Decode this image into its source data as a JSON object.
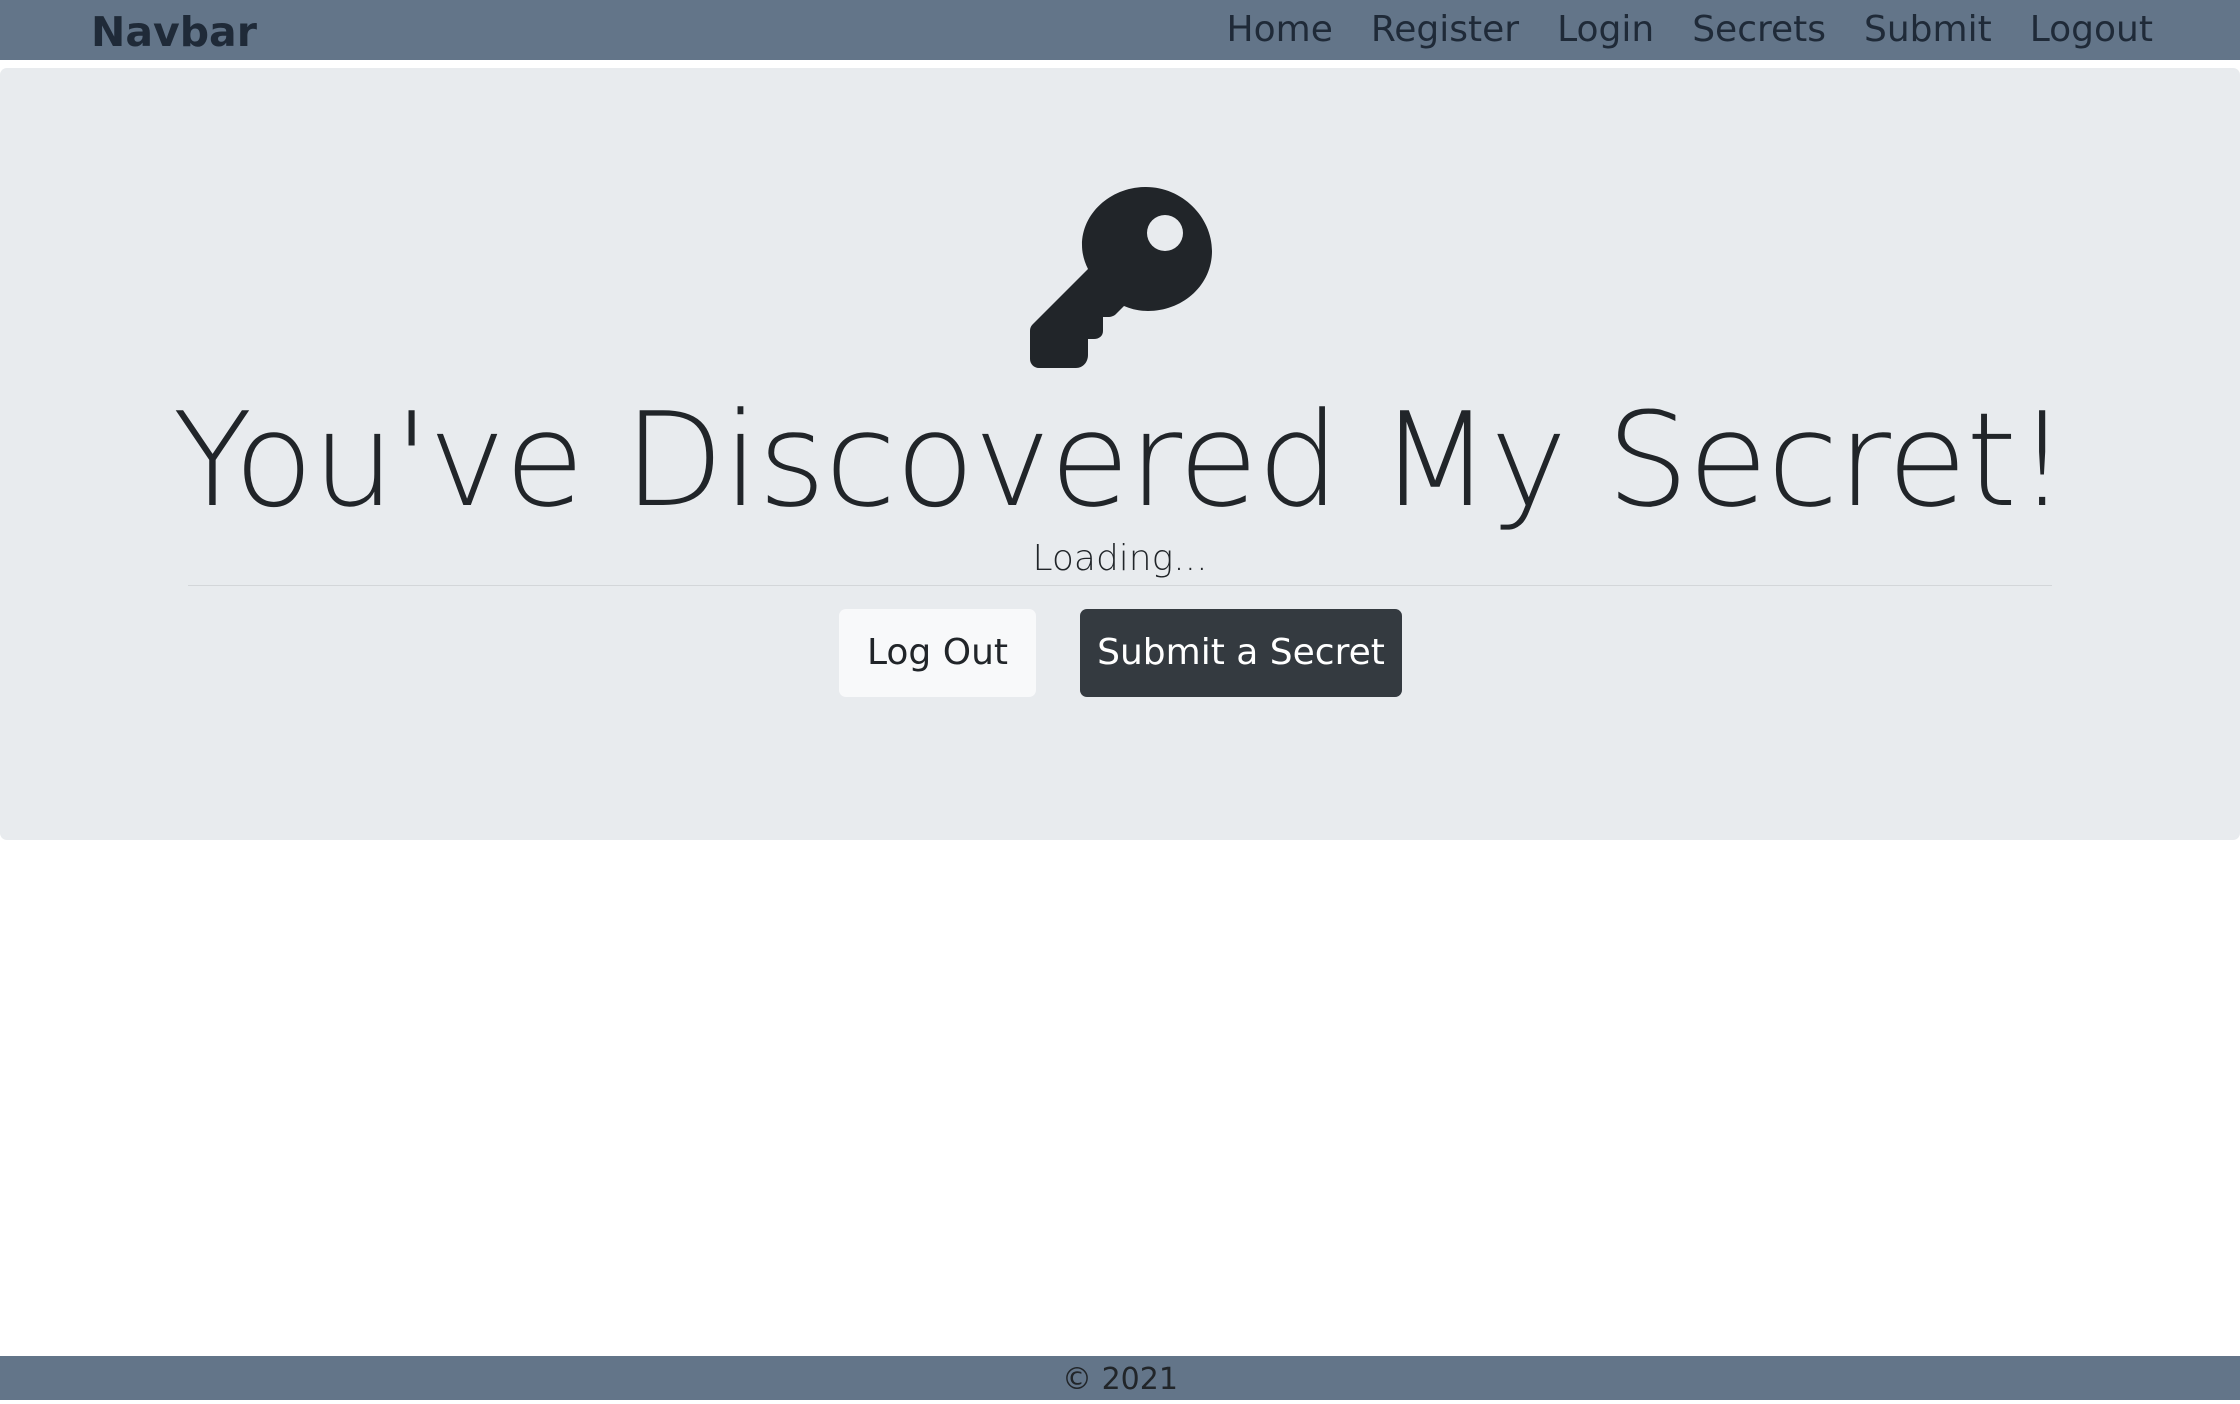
{
  "navbar": {
    "brand": "Navbar",
    "links": [
      "Home",
      "Register",
      "Login",
      "Secrets",
      "Submit",
      "Logout"
    ]
  },
  "hero": {
    "icon": "key-icon",
    "title": "You've Discovered My Secret!",
    "status": "Loading...",
    "buttons": {
      "logout": "Log Out",
      "submit": "Submit a Secret"
    }
  },
  "footer": {
    "copyright": "© 2021"
  },
  "colors": {
    "navbar_bg": "#637589",
    "jumbotron_bg": "#e8ebee",
    "dark_button": "#343a40",
    "light_button": "#f8f9fa",
    "text": "#212529"
  }
}
